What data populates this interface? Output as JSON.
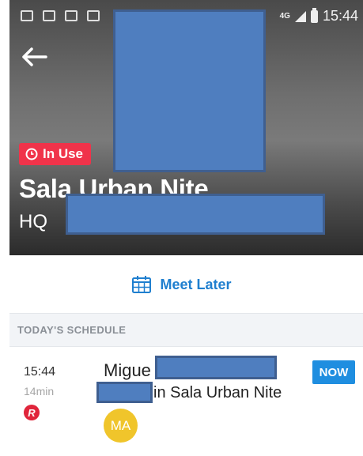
{
  "status_bar": {
    "network_label": "4G",
    "time": "15:44"
  },
  "header": {
    "status_label": "In Use",
    "room_name": "Sala Urban Nite",
    "location": "HQ"
  },
  "actions": {
    "meet_later_label": "Meet Later"
  },
  "schedule": {
    "section_title": "TODAY'S SCHEDULE",
    "items": [
      {
        "time": "15:44",
        "duration": "14min",
        "source_icon_letter": "R",
        "title_line1": "Migue",
        "title_line2": "in Sala Urban Nite",
        "badge": "NOW",
        "avatar_initials": "MA"
      }
    ]
  },
  "colors": {
    "in_use_red": "#f0334a",
    "accent_blue": "#1f7fcf",
    "now_badge_blue": "#1f8ee0",
    "avatar_yellow": "#f0c52b",
    "redaction_blue": "#4f7ebf"
  },
  "icons": [
    "back-arrow-icon",
    "clock-icon",
    "calendar-icon",
    "r-source-icon",
    "signal-icon",
    "battery-icon"
  ]
}
